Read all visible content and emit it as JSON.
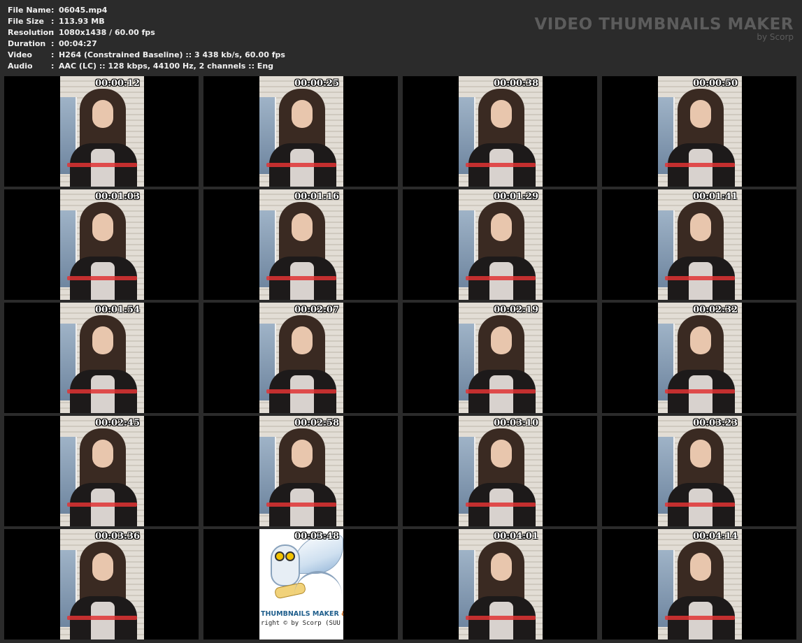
{
  "info": [
    {
      "key": "File Name",
      "sep": ":",
      "value": "06045.mp4"
    },
    {
      "key": "File Size",
      "sep": ":",
      "value": "113.93 MB"
    },
    {
      "key": "Resolution",
      "sep": ":",
      "value": "1080x1438 / 60.00 fps"
    },
    {
      "key": "Duration",
      "sep": ":",
      "value": "00:04:27"
    },
    {
      "key": "Video",
      "sep": ":",
      "value": "H264 (Constrained Baseline) :: 3 438 kb/s, 60.00 fps"
    },
    {
      "key": "Audio",
      "sep": ":",
      "value": "AAC (LC) :: 128 kbps, 44100 Hz, 2 channels :: Eng"
    }
  ],
  "brand": {
    "title": "VIDEO THUMBNAILS MAKER",
    "subtitle": "by Scorp"
  },
  "thumbnails": [
    {
      "time": "00:00:12"
    },
    {
      "time": "00:00:25"
    },
    {
      "time": "00:00:38"
    },
    {
      "time": "00:00:50"
    },
    {
      "time": "00:01:03"
    },
    {
      "time": "00:01:16"
    },
    {
      "time": "00:01:29"
    },
    {
      "time": "00:01:41"
    },
    {
      "time": "00:01:54"
    },
    {
      "time": "00:02:07"
    },
    {
      "time": "00:02:19"
    },
    {
      "time": "00:02:32"
    },
    {
      "time": "00:02:45"
    },
    {
      "time": "00:02:58"
    },
    {
      "time": "00:03:10"
    },
    {
      "time": "00:03:23"
    },
    {
      "time": "00:03:36"
    },
    {
      "time": "00:03:48"
    },
    {
      "time": "00:04:01"
    },
    {
      "time": "00:04:14"
    }
  ],
  "logo_frame": {
    "line1_main": "THUMBNAILS MAKER ",
    "line1_amp": "& A",
    "line2": "right © by Scorp (SUU D"
  }
}
